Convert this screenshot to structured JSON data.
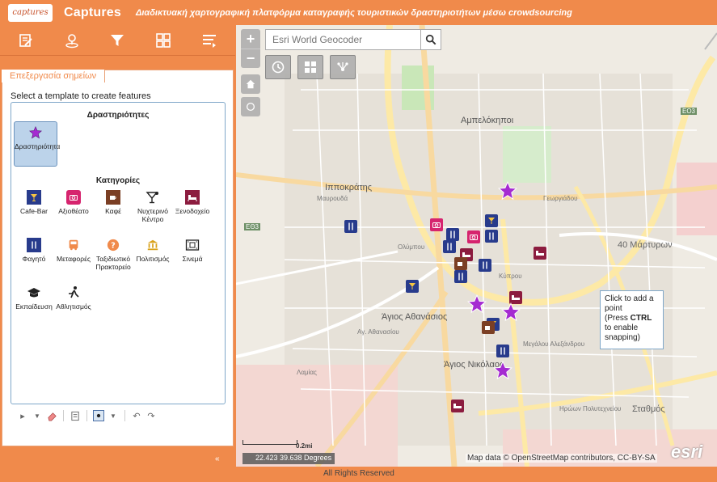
{
  "header": {
    "logo_text": "captures",
    "title": "Captures",
    "subtitle": "Διαδικτυακή χαρτογραφική πλατφόρμα καταγραφής τουριστικών δραστηριοτήτων μέσω crowdsourcing"
  },
  "toolbar": {
    "items": [
      "edit-icon",
      "location-icon",
      "filter-icon",
      "grid-icon",
      "list-icon"
    ]
  },
  "panel": {
    "tab_label": "Επεξεργασία σημείων",
    "select_text": "Select a template to create features",
    "groups": [
      {
        "title": "Δραστηριότητες",
        "items": [
          {
            "label": "Δραστηριότητα",
            "icon": "star-icon"
          }
        ]
      },
      {
        "title": "Κατηγορίες",
        "items": [
          {
            "label": "Cafe-Bar",
            "icon": "cocktail-icon"
          },
          {
            "label": "Αξιοθέατο",
            "icon": "camera-icon"
          },
          {
            "label": "Καφέ",
            "icon": "coffee-icon"
          },
          {
            "label": "Νυχτερινό Κέντρο",
            "icon": "nightclub-icon"
          },
          {
            "label": "Ξενοδοχείο",
            "icon": "bed-icon"
          },
          {
            "label": "Φαγητό",
            "icon": "fork-knife-icon"
          },
          {
            "label": "Μεταφορές",
            "icon": "bus-icon"
          },
          {
            "label": "Ταξιδιωτικό Πρακτορείο",
            "icon": "question-icon"
          },
          {
            "label": "Πολιτισμός",
            "icon": "museum-icon"
          },
          {
            "label": "Σινεμά",
            "icon": "cinema-icon"
          },
          {
            "label": "Εκπαίδευση",
            "icon": "graduation-icon"
          },
          {
            "label": "Αθλητισμός",
            "icon": "runner-icon"
          }
        ]
      }
    ]
  },
  "map": {
    "search_placeholder": "Esri World Geocoder",
    "tooltip": {
      "line1": "Click to add a point",
      "line2_prefix": "(Press ",
      "line2_key": "CTRL",
      "line2_suffix": " to enable snapping)"
    },
    "coordinates": "22.423 39.638 Degrees",
    "scale_label": "0.2mi",
    "attribution": "Map data © OpenStreetMap contributors, CC-BY-SA",
    "esri_logo": "esri",
    "labels": [
      "Αμπελόκηποι",
      "Ιπποκράτης",
      "Άγιος Αθανάσιος",
      "Άγιος Νικόλαος",
      "40 Μάρτυρων",
      "Σταθμός",
      "Μαυρουδά",
      "Γεωργιάδου",
      "Κύπρου",
      "Ηρώων Πολυτεχνείου",
      "Λαμίας",
      "Αγ. Αθανασίου",
      "Μεγάλου Αλεξάνδρου",
      "Ολύμπου",
      "ΕΘ3",
      "ΕΟ3"
    ]
  },
  "footer": {
    "rights": "All Rights Reserved"
  },
  "colors": {
    "brand": "#f08a4b",
    "accent_blue": "#283b8c",
    "highlight": "#bcd3ea"
  }
}
